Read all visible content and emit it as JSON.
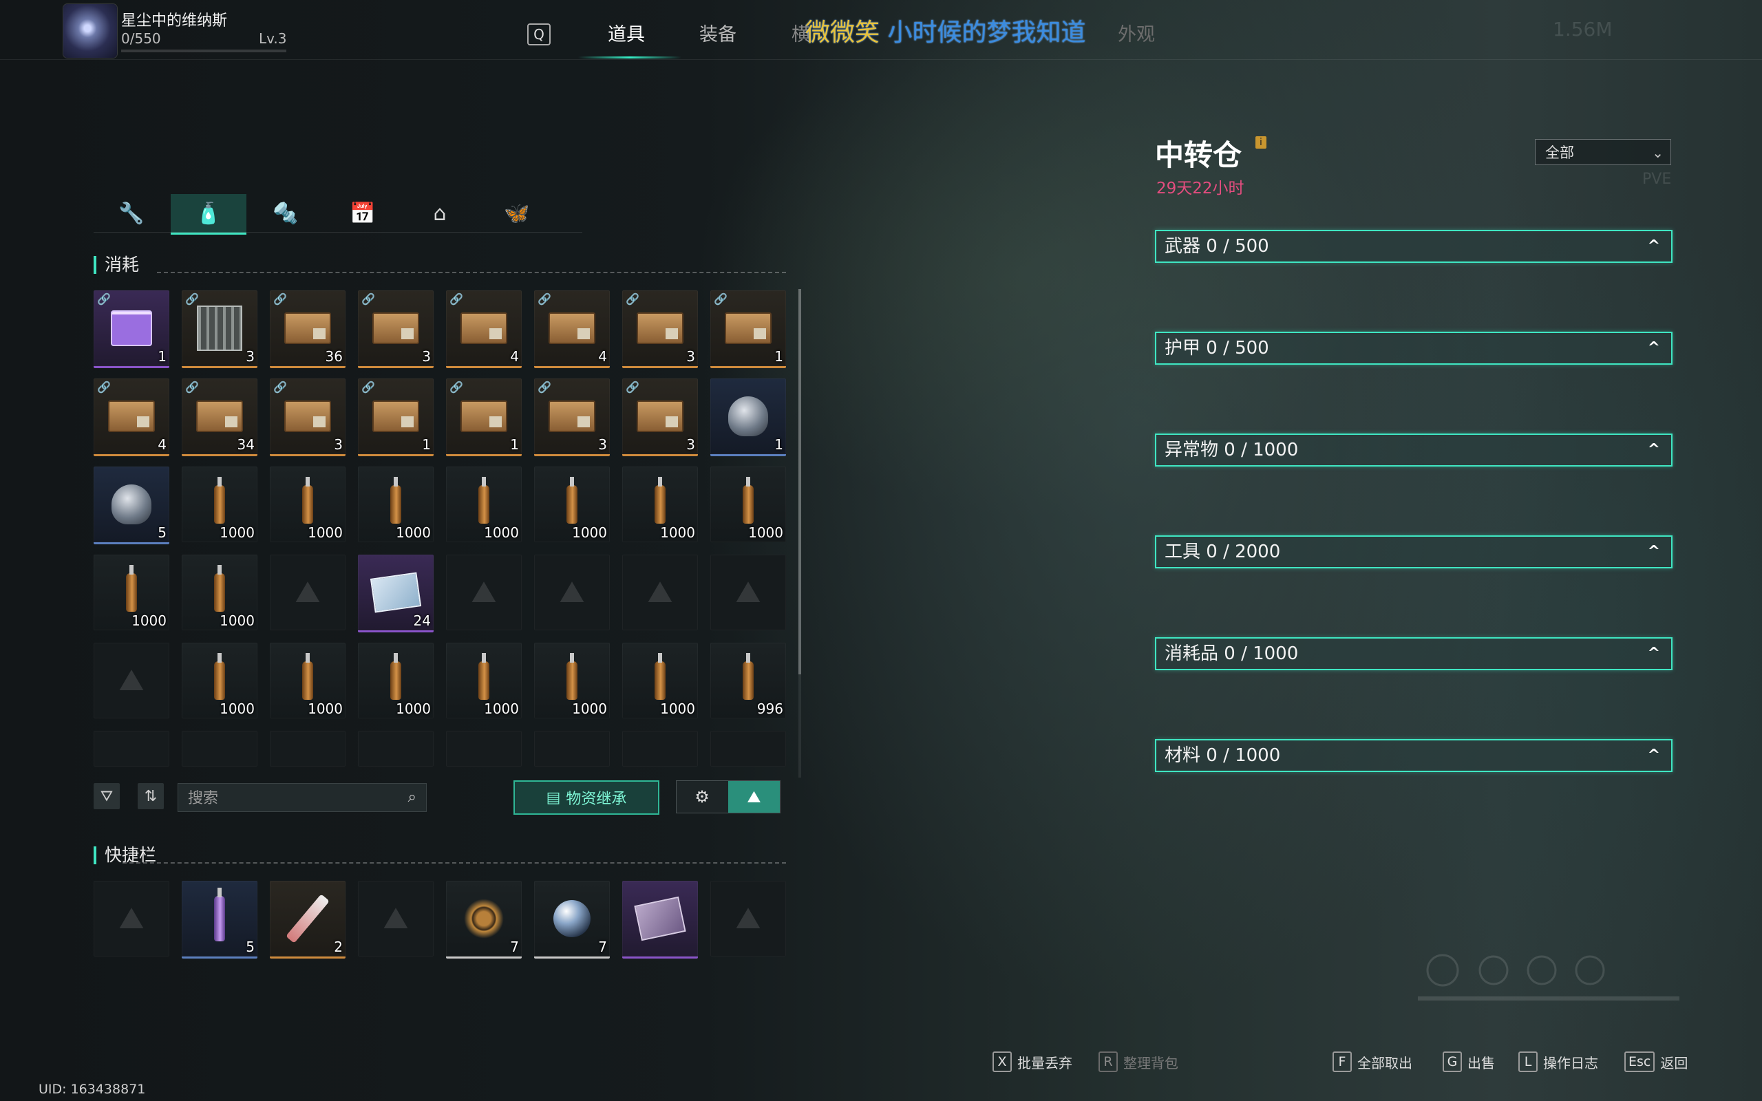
{
  "player": {
    "name": "星尘中的维纳斯",
    "exp": "0/550",
    "level": "Lv.3",
    "exp_fraction": 0.0
  },
  "top_nav": {
    "key_hint": "Q",
    "tabs": [
      "道具",
      "装备",
      "横",
      "外观"
    ],
    "active_tab": "道具",
    "overlay_title_yellow": "微微笑",
    "overlay_title_blue": " 小时候的梦我知道",
    "right_faint": "1.56M"
  },
  "categories": [
    {
      "icon": "wrench-icon",
      "glyph": "🔧",
      "active": false
    },
    {
      "icon": "bottle-icon",
      "glyph": "🧴",
      "active": true
    },
    {
      "icon": "tool-icon",
      "glyph": "🔩",
      "active": false
    },
    {
      "icon": "event-calendar-icon",
      "glyph": "📅",
      "active": false
    },
    {
      "icon": "home-icon",
      "glyph": "⌂",
      "active": false
    },
    {
      "icon": "butterfly-icon",
      "glyph": "🦋",
      "active": false
    }
  ],
  "inventory": {
    "section_title": "消耗",
    "rows": [
      [
        {
          "type": "gift",
          "rarity": "purple",
          "qty": "1",
          "linked": true
        },
        {
          "type": "cage",
          "rarity": "gold",
          "qty": "3",
          "linked": true
        },
        {
          "type": "crate",
          "rarity": "gold",
          "qty": "36",
          "linked": true
        },
        {
          "type": "crate",
          "rarity": "gold",
          "qty": "3",
          "linked": true
        },
        {
          "type": "crate",
          "rarity": "gold",
          "qty": "4",
          "linked": true
        },
        {
          "type": "crate",
          "rarity": "gold",
          "qty": "4",
          "linked": true
        },
        {
          "type": "crate",
          "rarity": "gold",
          "qty": "3",
          "linked": true
        },
        {
          "type": "crate",
          "rarity": "gold",
          "qty": "1",
          "linked": true
        }
      ],
      [
        {
          "type": "crate",
          "rarity": "gold",
          "qty": "4",
          "linked": true
        },
        {
          "type": "crate",
          "rarity": "gold",
          "qty": "34",
          "linked": true
        },
        {
          "type": "crate",
          "rarity": "gold",
          "qty": "3",
          "linked": true
        },
        {
          "type": "crate",
          "rarity": "gold",
          "qty": "1",
          "linked": true
        },
        {
          "type": "crate",
          "rarity": "gold",
          "qty": "1",
          "linked": true
        },
        {
          "type": "crate",
          "rarity": "gold",
          "qty": "3",
          "linked": true
        },
        {
          "type": "crate",
          "rarity": "gold",
          "qty": "3",
          "linked": true
        },
        {
          "type": "helmet",
          "rarity": "blue",
          "qty": "1",
          "linked": false
        }
      ],
      [
        {
          "type": "helmet",
          "rarity": "blue",
          "qty": "5",
          "linked": false
        },
        {
          "type": "bottle",
          "rarity": "none",
          "qty": "1000",
          "linked": false
        },
        {
          "type": "bottle",
          "rarity": "none",
          "qty": "1000",
          "linked": false
        },
        {
          "type": "bottle",
          "rarity": "none",
          "qty": "1000",
          "linked": false
        },
        {
          "type": "bottle",
          "rarity": "none",
          "qty": "1000",
          "linked": false
        },
        {
          "type": "bottle",
          "rarity": "none",
          "qty": "1000",
          "linked": false
        },
        {
          "type": "bottle",
          "rarity": "none",
          "qty": "1000",
          "linked": false
        },
        {
          "type": "bottle",
          "rarity": "none",
          "qty": "1000",
          "linked": false
        }
      ],
      [
        {
          "type": "bottle",
          "rarity": "none",
          "qty": "1000",
          "linked": false
        },
        {
          "type": "bottle",
          "rarity": "none",
          "qty": "1000",
          "linked": false
        },
        {
          "type": "empty"
        },
        {
          "type": "card",
          "rarity": "purple",
          "qty": "24",
          "linked": false
        },
        {
          "type": "empty"
        },
        {
          "type": "empty"
        },
        {
          "type": "empty"
        },
        {
          "type": "empty"
        }
      ],
      [
        {
          "type": "empty"
        },
        {
          "type": "bottle",
          "rarity": "none",
          "qty": "1000",
          "linked": false
        },
        {
          "type": "bottle",
          "rarity": "none",
          "qty": "1000",
          "linked": false
        },
        {
          "type": "bottle",
          "rarity": "none",
          "qty": "1000",
          "linked": false
        },
        {
          "type": "bottle",
          "rarity": "none",
          "qty": "1000",
          "linked": false
        },
        {
          "type": "bottle",
          "rarity": "none",
          "qty": "1000",
          "linked": false
        },
        {
          "type": "bottle",
          "rarity": "none",
          "qty": "1000",
          "linked": false
        },
        {
          "type": "bottle",
          "rarity": "none",
          "qty": "996",
          "linked": false
        }
      ]
    ]
  },
  "controls": {
    "filter_icon": "filter-icon",
    "sort_icon": "sort-icon",
    "search_placeholder": "搜索",
    "inherit_label": "物资继承"
  },
  "quickbar": {
    "title": "快捷栏",
    "slots": [
      {
        "type": "empty"
      },
      {
        "type": "purple-bottle",
        "rarity": "blue",
        "qty": "5"
      },
      {
        "type": "syringe",
        "rarity": "gold",
        "qty": "2"
      },
      {
        "type": "empty"
      },
      {
        "type": "spiky",
        "rarity": "white",
        "qty": "7"
      },
      {
        "type": "orb",
        "rarity": "white",
        "qty": "7"
      },
      {
        "type": "book",
        "rarity": "purple",
        "qty": ""
      },
      {
        "type": "empty"
      }
    ]
  },
  "warehouse": {
    "title": "中转仓",
    "info_icon": "i",
    "timer": "29天22小时",
    "filter_value": "全部",
    "faint_mode": "PVE",
    "categories": [
      {
        "label": "武器 0 / 500"
      },
      {
        "label": "护甲 0 / 500"
      },
      {
        "label": "异常物 0 / 1000"
      },
      {
        "label": "工具 0 / 2000"
      },
      {
        "label": "消耗品 0 / 1000"
      },
      {
        "label": "材料 0 / 1000"
      }
    ]
  },
  "hints": [
    {
      "key": "X",
      "label": "批量丢弃",
      "dim": false
    },
    {
      "key": "R",
      "label": "整理背包",
      "dim": true
    },
    {
      "key": "F",
      "label": "全部取出",
      "dim": false
    },
    {
      "key": "G",
      "label": "出售",
      "dim": false
    },
    {
      "key": "L",
      "label": "操作日志",
      "dim": false
    },
    {
      "key": "Esc",
      "label": "返回",
      "dim": false
    }
  ],
  "uid": "UID: 163438871"
}
